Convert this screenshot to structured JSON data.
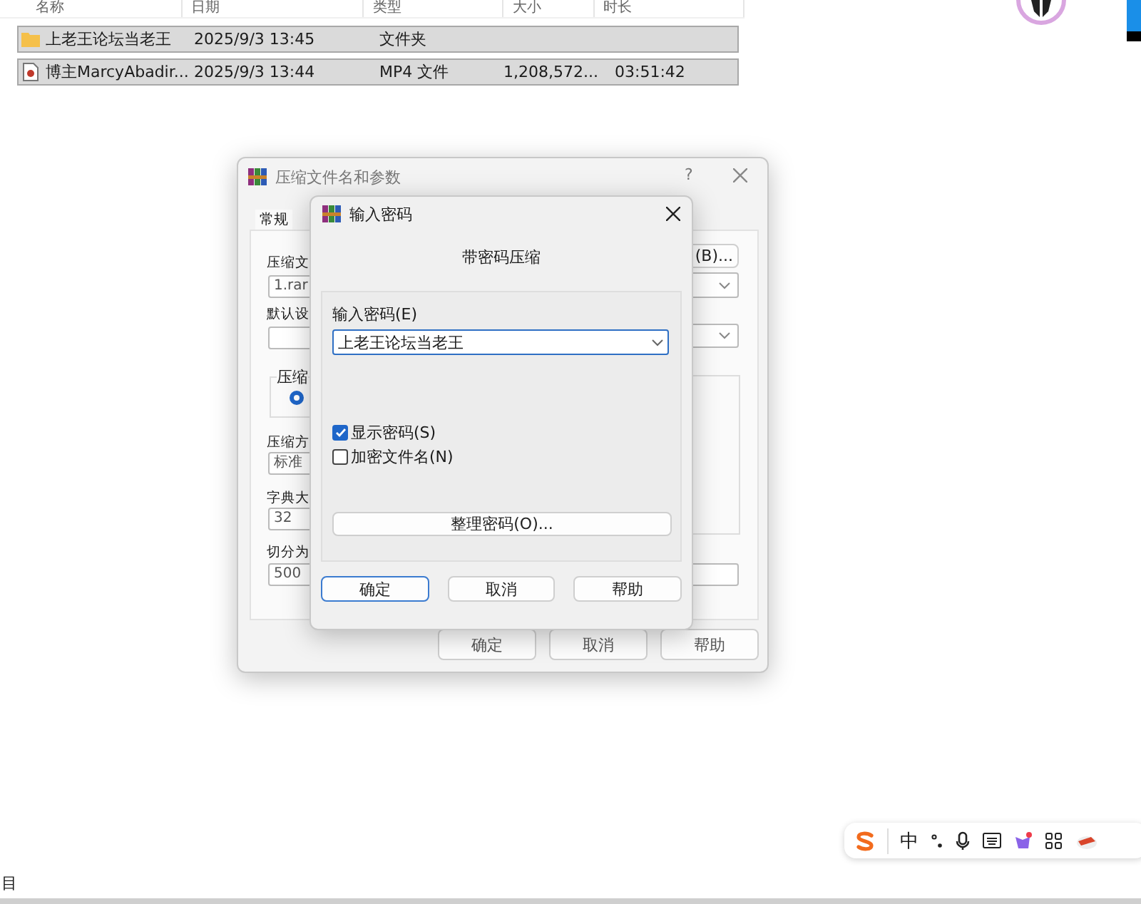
{
  "file_list": {
    "columns": [
      "名称",
      "日期",
      "类型",
      "大小",
      "时长"
    ],
    "rows": [
      {
        "kind": "folder",
        "name": "上老王论坛当老王",
        "date": "2025/9/3 13:45",
        "type": "文件夹",
        "selected": true
      },
      {
        "kind": "video",
        "name": "博主MarcyAbadir...",
        "date": "2025/9/3 13:44",
        "type": "MP4 文件",
        "size": "1,208,572...",
        "duration": "03:51:42",
        "selected": true
      }
    ]
  },
  "archive_dialog": {
    "title": "压缩文件名和参数",
    "help": "?",
    "tab": "常规",
    "name_label": "压缩文",
    "name_value": "1.rar",
    "browse_button": "(B)...",
    "profile_label": "默认设",
    "group_label": "压缩",
    "radio_selected": true,
    "method_label": "压缩方",
    "method_value": "标准",
    "dict_label": "字典大",
    "dict_value": "32",
    "split_label": "切分为",
    "split_value": "500",
    "buttons": [
      "确定",
      "取消",
      "帮助"
    ]
  },
  "password_dialog": {
    "title": "输入密码",
    "heading": "带密码压缩",
    "password_label": "输入密码(E)",
    "password_value": "上老王论坛当老王",
    "options": [
      {
        "label": "显示密码(S)",
        "checked": true
      },
      {
        "label": "加密文件名(N)",
        "checked": false
      }
    ],
    "organize_button": "整理密码(O)...",
    "buttons": [
      {
        "label": "确定",
        "selected": true
      },
      {
        "label": "取消",
        "selected": false
      },
      {
        "label": "帮助",
        "selected": false
      }
    ]
  },
  "ime_toolbar": {
    "mode": "中"
  },
  "corner_text": "目"
}
